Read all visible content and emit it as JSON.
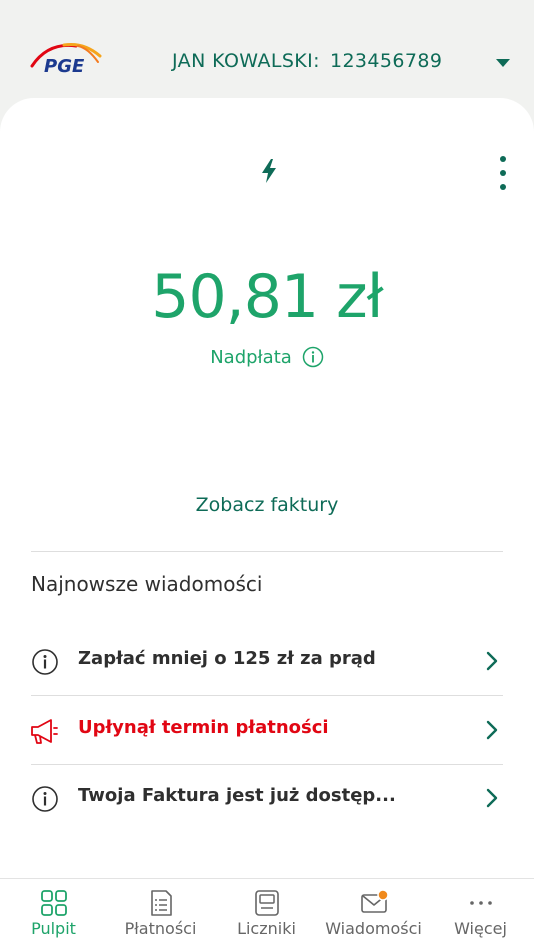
{
  "header": {
    "logo_text": "PGE",
    "account_name": "JAN KOWALSKI:",
    "account_number": "123456789"
  },
  "balance": {
    "amount": "50,81 zł",
    "status": "Nadpłata"
  },
  "invoices_link": "Zobacz faktury",
  "news": {
    "title": "Najnowsze wiadomości",
    "items": [
      {
        "icon": "info-icon",
        "text": "Zapłać mniej o 125 zł za prąd"
      },
      {
        "icon": "megaphone-icon",
        "text": "Upłynął termin płatności"
      },
      {
        "icon": "info-icon",
        "text": "Twoja Faktura jest już dostęp..."
      }
    ]
  },
  "nav": {
    "items": [
      {
        "icon": "dashboard-icon",
        "label": "Pulpit",
        "active": true
      },
      {
        "icon": "document-list-icon",
        "label": "Płatności"
      },
      {
        "icon": "meter-icon",
        "label": "Liczniki"
      },
      {
        "icon": "envelope-icon",
        "label": "Wiadomości"
      },
      {
        "icon": "more-dots-icon",
        "label": "Więcej"
      }
    ]
  },
  "colors": {
    "brand_green": "#1ea46a",
    "dark_green": "#0e6b57",
    "alert_red": "#e10613",
    "notification_orange": "#f08a1c"
  }
}
